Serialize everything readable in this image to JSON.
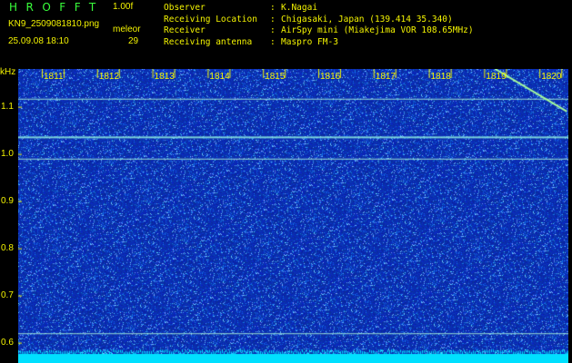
{
  "header": {
    "logo": "HROFFT",
    "version": "1.00f",
    "filename": "KN9_2509081810.png",
    "meteor_label": "meleor",
    "datetime": "25.09.08 18:10",
    "meteor_count": "29",
    "info": [
      {
        "key": "Observer",
        "value": "K.Nagai"
      },
      {
        "key": "Receiving Location",
        "value": "Chigasaki, Japan (139.414 35.340)"
      },
      {
        "key": "Receiver",
        "value": "AirSpy mini (Miakejima VOR 108.65MHz)"
      },
      {
        "key": "Receiving antenna",
        "value": "Maspro FM-3"
      }
    ]
  },
  "chart_data": {
    "type": "heatmap",
    "y_unit": "kHz",
    "x_ticks": [
      "1811",
      "1812",
      "1813",
      "1814",
      "1815",
      "1816",
      "1817",
      "1818",
      "1819",
      "1820"
    ],
    "y_ticks": [
      "1.1",
      "1.0",
      "0.9",
      "0.8",
      "0.7",
      "0.6"
    ],
    "ylim": [
      0.58,
      1.18
    ],
    "carrier_lines_khz": [
      1.117,
      1.037,
      0.99,
      0.62
    ],
    "meteor_trail": {
      "start": {
        "minute": 1819.0,
        "khz": 1.18
      },
      "end": {
        "minute": 1820.3,
        "khz": 1.09
      }
    },
    "colors": {
      "background": "#0d2bb0",
      "noise": "#4fa0ff",
      "line": "#b4ffd8",
      "trail": "#a8ff9a",
      "bottom_band": "#00e0ff",
      "text": "#f4f400"
    }
  }
}
